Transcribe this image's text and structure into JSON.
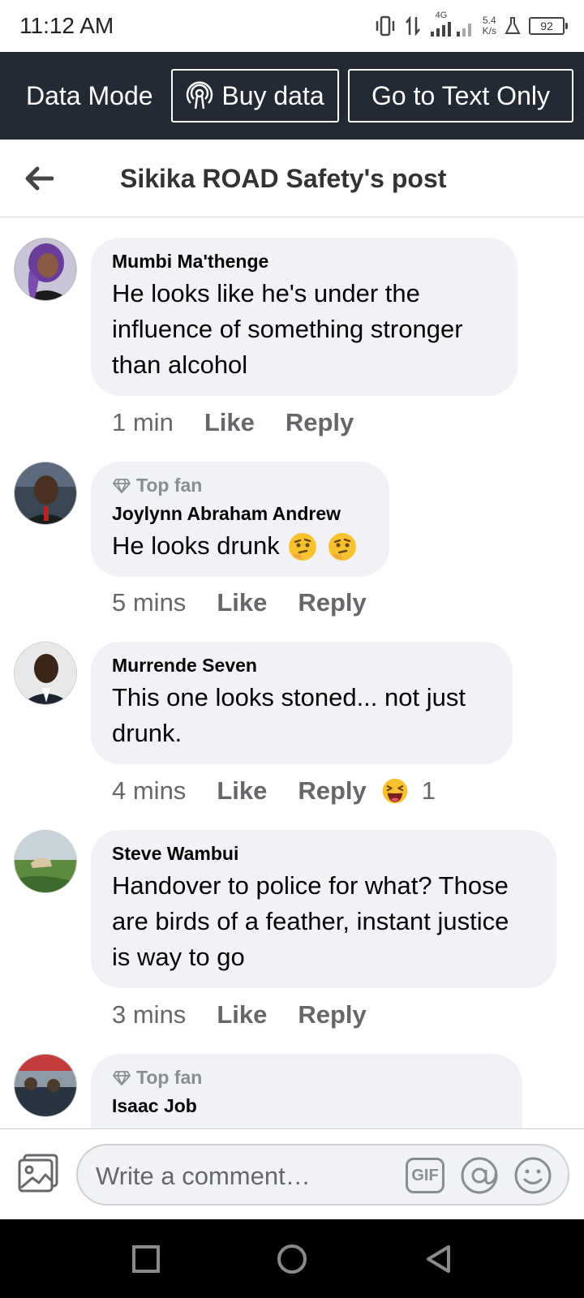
{
  "status_bar": {
    "time": "11:12 AM",
    "network_type": "4G",
    "net_speed_value": "5.4",
    "net_speed_unit": "K/s",
    "battery": "92"
  },
  "data_bar": {
    "mode_label": "Data Mode",
    "buy_data_label": "Buy data",
    "text_only_label": "Go to Text Only"
  },
  "header": {
    "title": "Sikika ROAD Safety's post"
  },
  "comments": [
    {
      "author": "Mumbi Ma'thenge",
      "top_fan": "",
      "text": "He looks like he's under the influence of something stronger than alcohol",
      "time": "1 min",
      "like": "Like",
      "reply": "Reply"
    },
    {
      "author": "Joylynn Abraham Andrew",
      "top_fan": "Top fan",
      "text": "He looks drunk",
      "emoji": [
        "thinking-face",
        "thinking-face"
      ],
      "time": "5 mins",
      "like": "Like",
      "reply": "Reply"
    },
    {
      "author": "Murrende Seven",
      "top_fan": "",
      "text": "This one looks stoned... not just drunk.",
      "time": "4 mins",
      "like": "Like",
      "reply": "Reply",
      "reaction": {
        "icon": "laughing-face",
        "count": "1"
      }
    },
    {
      "author": "Steve Wambui",
      "top_fan": "",
      "text": "Handover to police for what? Those are birds of a feather, instant justice is way to go",
      "time": "3 mins",
      "like": "Like",
      "reply": "Reply"
    },
    {
      "author": "Isaac Job",
      "top_fan": "Top fan",
      "text": ""
    }
  ],
  "composer": {
    "placeholder": "Write a comment…",
    "gif_label": "GIF"
  },
  "colors": {
    "data_bar_bg": "#242a33",
    "bubble_bg": "#f0f2f5",
    "meta_text": "#65676b"
  }
}
